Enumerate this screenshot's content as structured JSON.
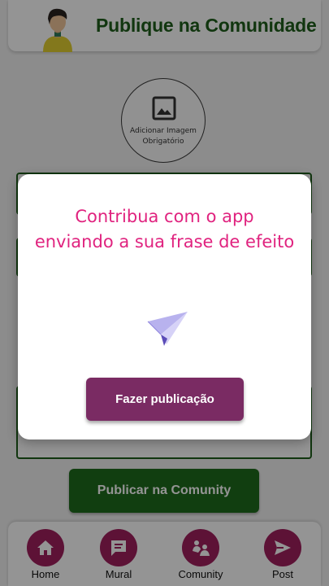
{
  "header": {
    "title": "Publique na Comunidade"
  },
  "image_upload": {
    "line1": "Adicionar Imagem",
    "line2": "Obrigatório"
  },
  "publish_button": "Publicar na Comunity",
  "bottom_nav": {
    "items": [
      {
        "label": "Home",
        "icon": "home-icon"
      },
      {
        "label": "Mural",
        "icon": "message-icon"
      },
      {
        "label": "Comunity",
        "icon": "community-icon"
      },
      {
        "label": "Post",
        "icon": "send-icon"
      }
    ]
  },
  "modal": {
    "message": "Contribua com o app enviando a sua frase de efeito",
    "cta_label": "Fazer publicação",
    "icon": "paper-plane-icon"
  },
  "colors": {
    "brand_green": "#1e5e1a",
    "accent_pink": "#e0237f",
    "nav_magenta": "#a01f5e",
    "cta_purple": "#7a2b63"
  }
}
